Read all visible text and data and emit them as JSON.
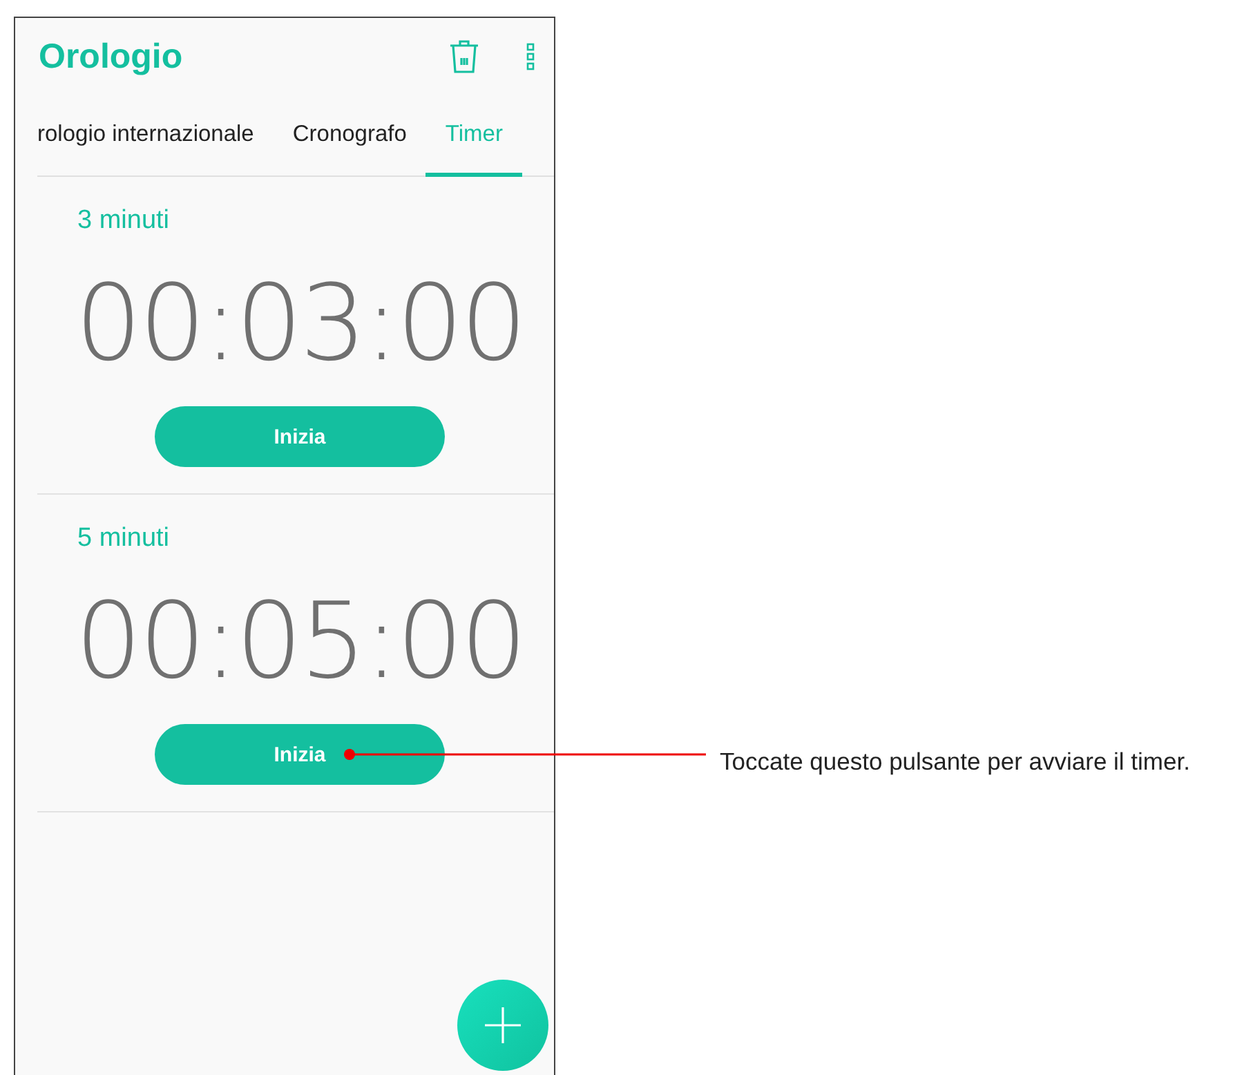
{
  "app_bar": {
    "title": "Orologio"
  },
  "tabs": [
    {
      "label": "rologio internazionale",
      "selected": false
    },
    {
      "label": "Cronografo",
      "selected": false
    },
    {
      "label": "Timer",
      "selected": true
    }
  ],
  "timers": [
    {
      "name": "3 minuti",
      "time": "00:03:00",
      "button": "Inizia"
    },
    {
      "name": "5 minuti",
      "time": "00:05:00",
      "button": "Inizia"
    }
  ],
  "callout": {
    "text": "Toccate questo pulsante per avviare il timer."
  }
}
